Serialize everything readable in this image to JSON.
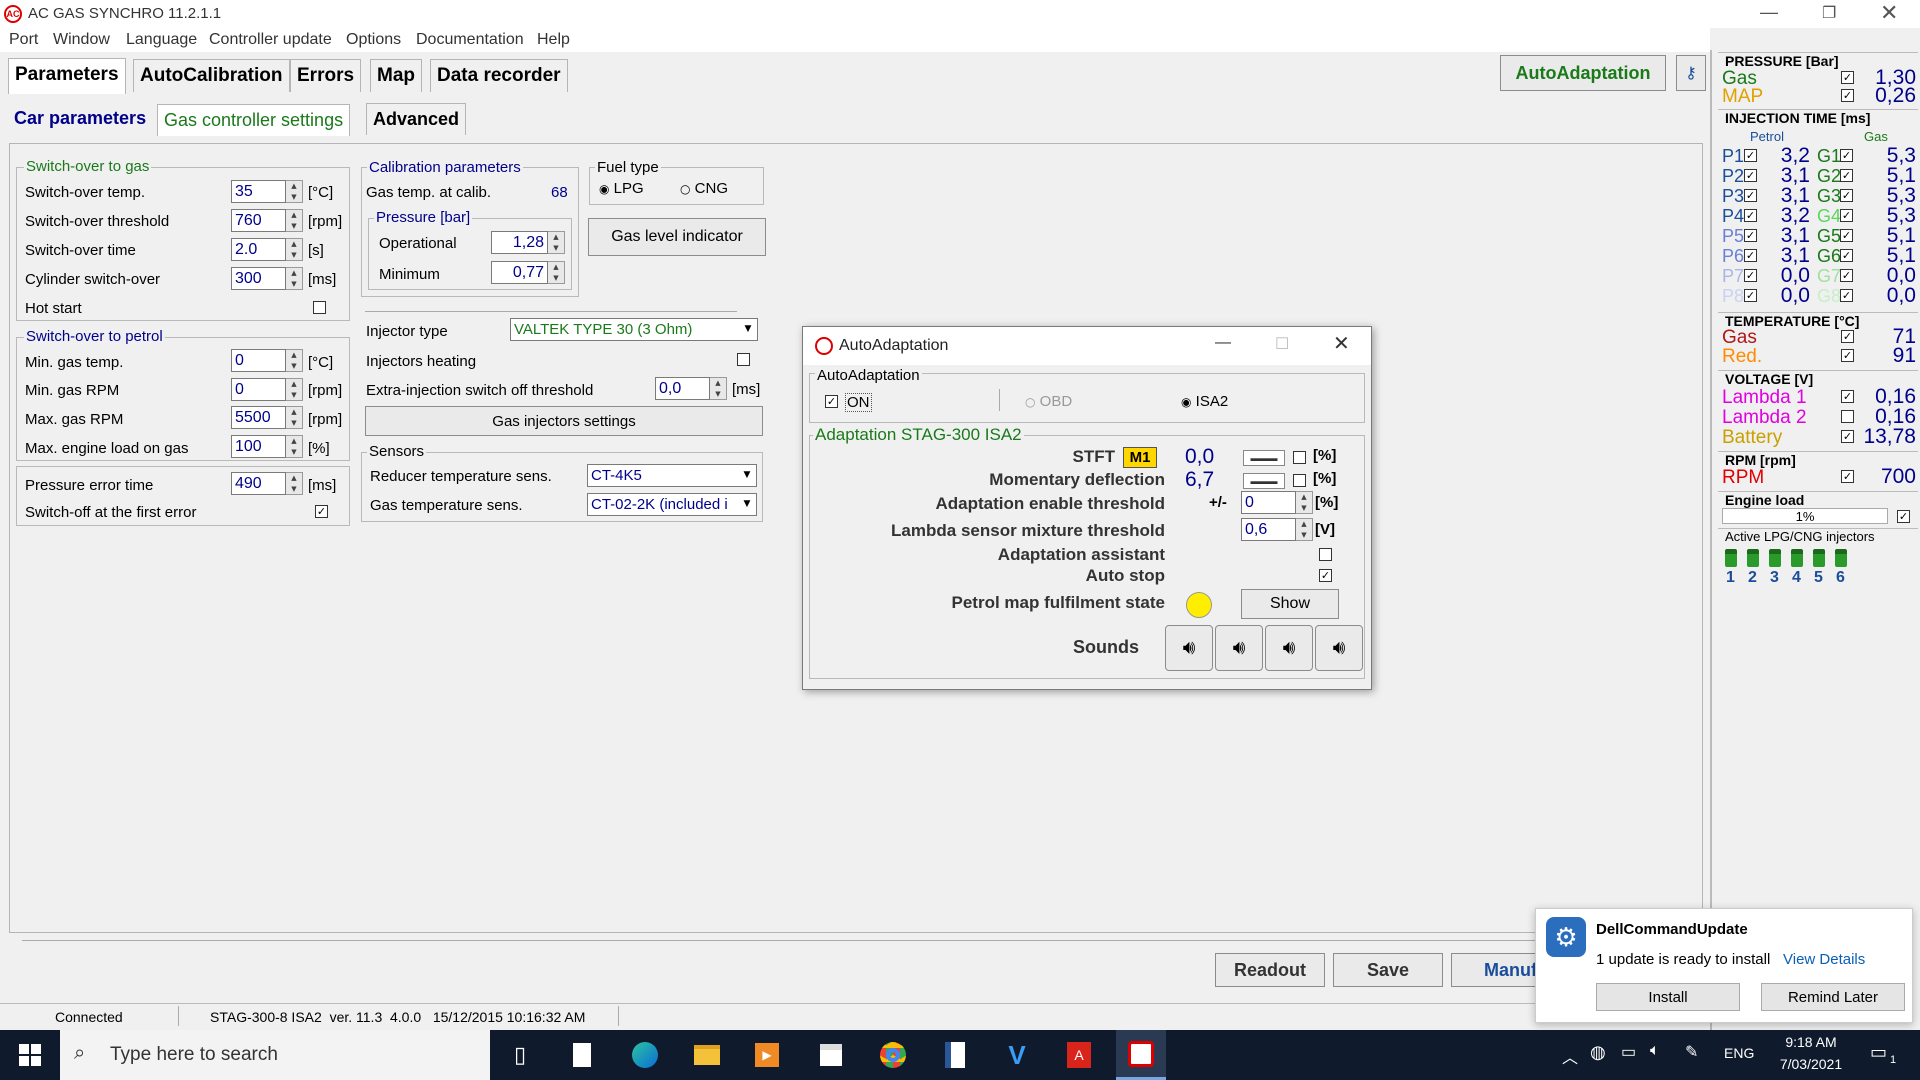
{
  "window": {
    "title": "AC GAS SYNCHRO  11.2.1.1",
    "logo_text": "AC"
  },
  "menu": [
    "Port",
    "Window",
    "Language",
    "Controller update",
    "Options",
    "Documentation",
    "Help"
  ],
  "tabs": [
    "Parameters",
    "AutoCalibration",
    "Errors",
    "Map",
    "Data recorder"
  ],
  "subtabs": [
    "Car parameters",
    "Gas controller settings",
    "Advanced"
  ],
  "autoadapt_button": "AutoAdaptation",
  "switch_gas": {
    "title": "Switch-over to gas",
    "rows": [
      {
        "label": "Switch-over temp.",
        "value": "35",
        "unit": "[°C]"
      },
      {
        "label": "Switch-over threshold",
        "value": "760",
        "unit": "[rpm]"
      },
      {
        "label": "Switch-over time",
        "value": "2.0",
        "unit": "[s]"
      },
      {
        "label": "Cylinder switch-over",
        "value": "300",
        "unit": "[ms]"
      }
    ],
    "hot_start": "Hot start"
  },
  "switch_petrol": {
    "title": "Switch-over to petrol",
    "rows": [
      {
        "label": "Min. gas temp.",
        "value": "0",
        "unit": "[°C]"
      },
      {
        "label": "Min. gas RPM",
        "value": "0",
        "unit": "[rpm]"
      },
      {
        "label": "Max. gas RPM",
        "value": "5500",
        "unit": "[rpm]"
      },
      {
        "label": "Max. engine load on gas",
        "value": "100",
        "unit": "[%]"
      }
    ]
  },
  "pressure_err": {
    "label": "Pressure error time",
    "value": "490",
    "unit": "[ms]",
    "switch_off": "Switch-off at the first error"
  },
  "calib": {
    "title": "Calibration parameters",
    "gas_temp_label": "Gas temp. at calib.",
    "gas_temp_value": "68",
    "pressure_title": "Pressure [bar]",
    "operational_label": "Operational",
    "operational_value": "1,28",
    "minimum_label": "Minimum",
    "minimum_value": "0,77"
  },
  "fuel": {
    "title": "Fuel type",
    "lpg": "LPG",
    "cng": "CNG"
  },
  "gas_level_btn": "Gas level indicator",
  "injector": {
    "type_label": "Injector type",
    "type_value": "VALTEK TYPE 30 (3 Ohm)",
    "heating": "Injectors heating",
    "extra_label": "Extra-injection switch off threshold",
    "extra_value": "0,0",
    "extra_unit": "[ms]",
    "settings_btn": "Gas injectors settings"
  },
  "sensors": {
    "title": "Sensors",
    "reducer_label": "Reducer temperature sens.",
    "reducer_value": "CT-4K5",
    "gas_label": "Gas temperature sens.",
    "gas_value": "CT-02-2K (included i"
  },
  "dialog": {
    "title": "AutoAdaptation",
    "group": "AutoAdaptation",
    "on": "ON",
    "obd": "OBD",
    "isa2": "ISA2",
    "adapt_title": "Adaptation STAG-300 ISA2",
    "stft_label": "STFT",
    "stft_badge": "M1",
    "stft_value": "0,0",
    "pct": "[%]",
    "mom_label": "Momentary deflection",
    "mom_value": "6,7",
    "enable_label": "Adaptation enable threshold",
    "enable_pm": "+/-",
    "enable_value": "0",
    "lambda_label": "Lambda sensor mixture threshold",
    "lambda_value": "0,6",
    "volt": "[V]",
    "assistant": "Adaptation assistant",
    "autostop": "Auto stop",
    "petrol_map": "Petrol map fulfilment state",
    "show": "Show",
    "sounds": "Sounds",
    "indicator_color": "#ffee00"
  },
  "bottom": {
    "readout": "Readout",
    "save": "Save",
    "manuf": "Manufacturer"
  },
  "status": {
    "connected": "Connected",
    "info": "STAG-300-8 ISA2  ver. 11.3  4.0.0   15/12/2015 10:16:32 AM"
  },
  "right": {
    "pressure_title": "PRESSURE [Bar]",
    "gas": "Gas",
    "gas_value": "1,30",
    "map": "MAP",
    "map_value": "0,26",
    "inj_title": "INJECTION TIME [ms]",
    "petrol_col": "Petrol",
    "gas_col": "Gas",
    "inj": [
      {
        "p": "P1",
        "pv": "3,2",
        "g": "G1",
        "gv": "5,3"
      },
      {
        "p": "P2",
        "pv": "3,1",
        "g": "G2",
        "gv": "5,1"
      },
      {
        "p": "P3",
        "pv": "3,1",
        "g": "G3",
        "gv": "5,3"
      },
      {
        "p": "P4",
        "pv": "3,2",
        "g": "G4",
        "gv": "5,3"
      },
      {
        "p": "P5",
        "pv": "3,1",
        "g": "G5",
        "gv": "5,1"
      },
      {
        "p": "P6",
        "pv": "3,1",
        "g": "G6",
        "gv": "5,1"
      },
      {
        "p": "P7",
        "pv": "0,0",
        "g": "G7",
        "gv": "0,0"
      },
      {
        "p": "P8",
        "pv": "0,0",
        "g": "G8",
        "gv": "0,0"
      }
    ],
    "temp_title": "TEMPERATURE [°C]",
    "t_gas": "Gas",
    "t_gas_value": "71",
    "t_red": "Red.",
    "t_red_value": "91",
    "volt_title": "VOLTAGE [V]",
    "l1": "Lambda 1",
    "l1_value": "0,16",
    "l2": "Lambda 2",
    "l2_value": "0,16",
    "bat": "Battery",
    "bat_value": "13,78",
    "rpm_title": "RPM [rpm]",
    "rpm": "RPM",
    "rpm_value": "700",
    "load_title": "Engine load",
    "load_value": "1%",
    "active_title": "Active LPG/CNG injectors",
    "active": [
      "1",
      "2",
      "3",
      "4",
      "5",
      "6"
    ]
  },
  "toast": {
    "app": "DellCommandUpdate",
    "msg": "1 update is ready to install",
    "link": "View Details",
    "install": "Install",
    "remind": "Remind Later"
  },
  "taskbar": {
    "search": "Type here to search",
    "lang": "ENG",
    "time": "9:18 AM",
    "date": "7/03/2021",
    "notif": "1"
  }
}
